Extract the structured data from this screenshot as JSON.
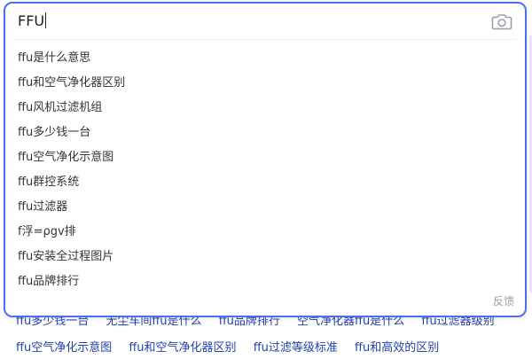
{
  "search": {
    "query": "FFU",
    "feedback_label": "反馈"
  },
  "suggestions": [
    "ffu是什么意思",
    "ffu和空气净化器区别",
    "ffu风机过滤机组",
    "ffu多少钱一台",
    "ffu空气净化示意图",
    "ffu群控系统",
    "ffu过滤器",
    "f浮=ρgv排",
    "ffu安装全过程图片",
    "ffu品牌排行"
  ],
  "related_searches": {
    "row1": [
      "ffu多少钱一台",
      "无尘车间ffu是什么",
      "ffu品牌排行",
      "空气净化器ffu是什么",
      "ffu过滤器级别"
    ],
    "row2": [
      "ffu空气净化示意图",
      "ffu和空气净化器区别",
      "ffu过滤等级标准",
      "ffu和高效的区别"
    ]
  },
  "icons": {
    "camera": "camera-icon"
  },
  "colors": {
    "accent": "#4e6ef2",
    "link": "#2440b3",
    "muted": "#9aa0aa"
  }
}
